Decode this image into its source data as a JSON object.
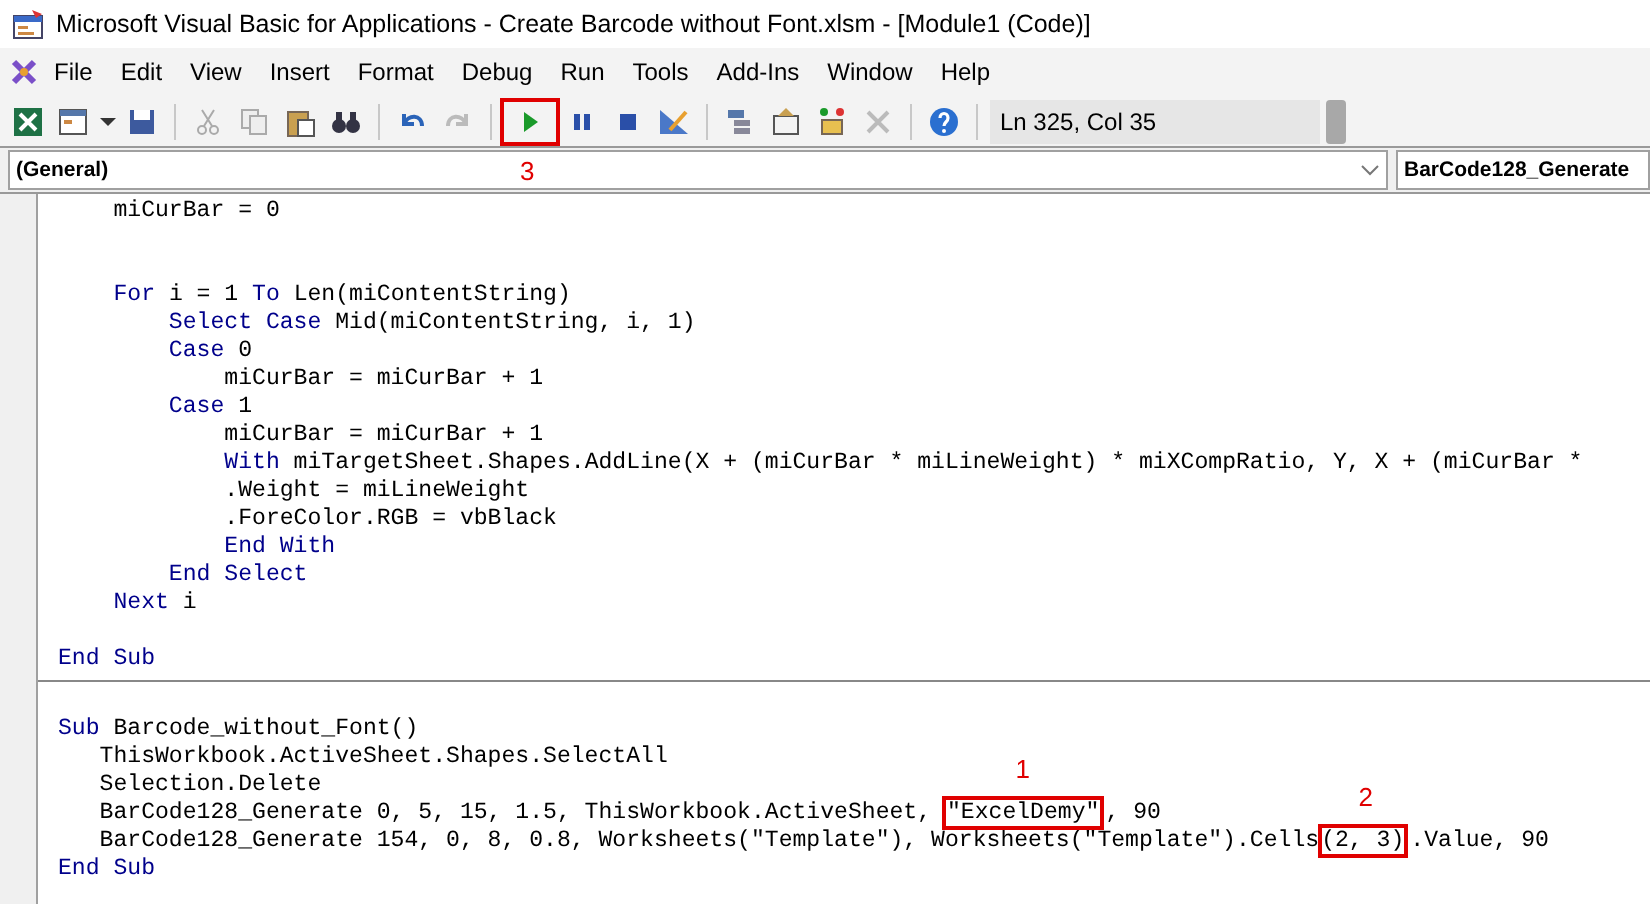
{
  "window": {
    "title": "Microsoft Visual Basic for Applications - Create Barcode without Font.xlsm - [Module1 (Code)]"
  },
  "menu": [
    "File",
    "Edit",
    "View",
    "Insert",
    "Format",
    "Debug",
    "Run",
    "Tools",
    "Add-Ins",
    "Window",
    "Help"
  ],
  "toolbar": {
    "run_callout": "3",
    "position": "Ln 325, Col 35"
  },
  "object_combo": {
    "value": "(General)"
  },
  "procedure_combo": {
    "value": "BarCode128_Generate"
  },
  "code": [
    {
      "kind": "line",
      "segments": [
        {
          "kind": "code",
          "text": "    miCurBar = 0"
        }
      ]
    },
    {
      "kind": "blank"
    },
    {
      "kind": "blank"
    },
    {
      "kind": "line",
      "segments": [
        {
          "kind": "keyword",
          "text": "    For"
        },
        {
          "kind": "code",
          "text": " i = 1 "
        },
        {
          "kind": "keyword",
          "text": "To"
        },
        {
          "kind": "code",
          "text": " Len(miContentString)"
        }
      ]
    },
    {
      "kind": "line",
      "segments": [
        {
          "kind": "keyword",
          "text": "        Select Case"
        },
        {
          "kind": "code",
          "text": " Mid(miContentString, i, 1)"
        }
      ]
    },
    {
      "kind": "line",
      "segments": [
        {
          "kind": "keyword",
          "text": "        Case"
        },
        {
          "kind": "code",
          "text": " 0"
        }
      ]
    },
    {
      "kind": "line",
      "segments": [
        {
          "kind": "code",
          "text": "            miCurBar = miCurBar + 1"
        }
      ]
    },
    {
      "kind": "line",
      "segments": [
        {
          "kind": "keyword",
          "text": "        Case"
        },
        {
          "kind": "code",
          "text": " 1"
        }
      ]
    },
    {
      "kind": "line",
      "segments": [
        {
          "kind": "code",
          "text": "            miCurBar = miCurBar + 1"
        }
      ]
    },
    {
      "kind": "line",
      "segments": [
        {
          "kind": "keyword",
          "text": "            With"
        },
        {
          "kind": "code",
          "text": " miTargetSheet.Shapes.AddLine(X + (miCurBar * miLineWeight) * miXCompRatio, Y, X + (miCurBar *"
        }
      ]
    },
    {
      "kind": "line",
      "segments": [
        {
          "kind": "code",
          "text": "            .Weight = miLineWeight"
        }
      ]
    },
    {
      "kind": "line",
      "segments": [
        {
          "kind": "code",
          "text": "            .ForeColor.RGB = vbBlack"
        }
      ]
    },
    {
      "kind": "line",
      "segments": [
        {
          "kind": "keyword",
          "text": "            End With"
        }
      ]
    },
    {
      "kind": "line",
      "segments": [
        {
          "kind": "keyword",
          "text": "        End Select"
        }
      ]
    },
    {
      "kind": "line",
      "segments": [
        {
          "kind": "keyword",
          "text": "    Next"
        },
        {
          "kind": "code",
          "text": " i"
        }
      ]
    },
    {
      "kind": "blank"
    },
    {
      "kind": "line",
      "segments": [
        {
          "kind": "keyword",
          "text": "End Sub"
        }
      ]
    },
    {
      "kind": "separator"
    },
    {
      "kind": "blank"
    },
    {
      "kind": "line",
      "segments": [
        {
          "kind": "keyword",
          "text": "Sub"
        },
        {
          "kind": "code",
          "text": " Barcode_without_Font()"
        }
      ]
    },
    {
      "kind": "line",
      "segments": [
        {
          "kind": "code",
          "text": "   ThisWorkbook.ActiveSheet.Shapes.SelectAll"
        }
      ]
    },
    {
      "kind": "line",
      "segments": [
        {
          "kind": "code",
          "text": "   Selection.Delete"
        }
      ]
    },
    {
      "kind": "line",
      "segments": [
        {
          "kind": "code",
          "text": "   BarCode128_Generate 0, 5, 15, 1.5, ThisWorkbook.ActiveSheet, "
        },
        {
          "kind": "code",
          "text": "\"ExcelDemy\"",
          "callout": "1"
        },
        {
          "kind": "code",
          "text": ", 90"
        }
      ]
    },
    {
      "kind": "line",
      "segments": [
        {
          "kind": "code",
          "text": "   BarCode128_Generate 154, 0, 8, 0.8, Worksheets(\"Template\"), Worksheets(\"Template\").Cells"
        },
        {
          "kind": "code",
          "text": "(2, 3)",
          "callout": "2"
        },
        {
          "kind": "code",
          "text": ".Value, 90"
        }
      ]
    },
    {
      "kind": "line",
      "segments": [
        {
          "kind": "keyword",
          "text": "End Sub"
        }
      ]
    }
  ]
}
